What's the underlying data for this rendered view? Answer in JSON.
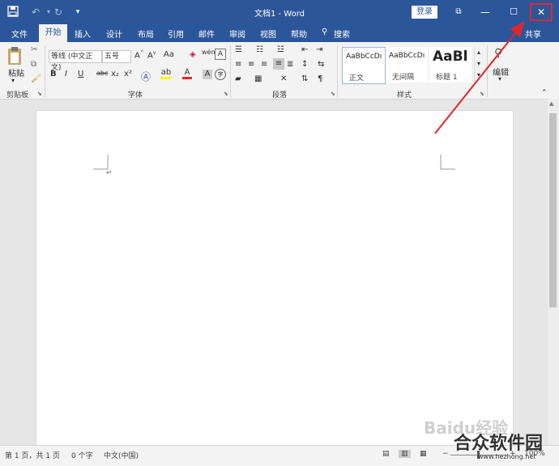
{
  "titlebar": {
    "title": "文档1 - Word",
    "login": "登录",
    "quick_access": {
      "save_icon": "save-icon",
      "undo_icon": "undo-icon",
      "redo_icon": "redo-icon"
    },
    "controls": {
      "minimize": "—",
      "maximize": "☐",
      "close": "✕",
      "restore": "⧉"
    }
  },
  "tabs": [
    "文件",
    "开始",
    "插入",
    "设计",
    "布局",
    "引用",
    "邮件",
    "审阅",
    "视图",
    "帮助"
  ],
  "search_label": "搜索",
  "share_label": "共享",
  "ribbon": {
    "clipboard": {
      "paste": "粘贴",
      "group": "剪贴板"
    },
    "font": {
      "font_name": "等线 (中文正文)",
      "font_size": "五号",
      "group": "字体",
      "buttons": [
        "B",
        "I",
        "U",
        "abc",
        "x₂",
        "x²",
        "A",
        "A",
        "Aa",
        "wén",
        "A",
        "A",
        "字"
      ]
    },
    "paragraph": {
      "group": "段落"
    },
    "styles": {
      "group": "样式",
      "items": [
        {
          "sample": "AaBbCcDı",
          "name": "正文"
        },
        {
          "sample": "AaBbCcDı",
          "name": "无间隔"
        },
        {
          "sample": "AaBl",
          "name": "标题 1"
        }
      ]
    },
    "editing": {
      "label": "编辑"
    }
  },
  "document": {
    "paragraph_mark": "↵"
  },
  "statusbar": {
    "page": "第 1 页，共 1 页",
    "words": "0 个字",
    "language": "中文(中国)",
    "zoom": "100%"
  },
  "watermark": {
    "text": "合众软件园",
    "url": "www.hezhong.net",
    "brand": "Baidu经验"
  },
  "colors": {
    "accent": "#2b579a",
    "highlight_red": "#e0262d"
  }
}
